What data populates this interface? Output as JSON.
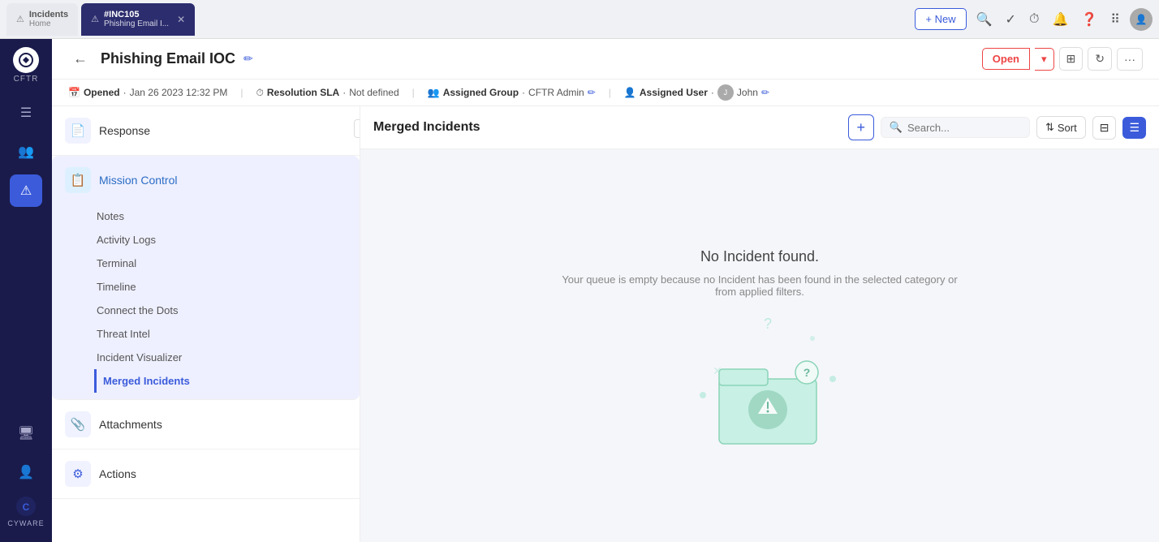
{
  "tabs": [
    {
      "id": "incidents-home",
      "label": "Incidents",
      "sublabel": "Home",
      "icon": "⚠",
      "active": false
    },
    {
      "id": "inc105",
      "label": "#INC105",
      "sublabel": "Phishing Email I...",
      "icon": "⚠",
      "active": true,
      "closable": true
    }
  ],
  "topbar": {
    "new_label": "+ New",
    "icons": [
      "search",
      "check",
      "clock",
      "bell",
      "question",
      "grid",
      "avatar"
    ]
  },
  "header": {
    "back_label": "←",
    "title": "Phishing Email IOC",
    "edit_icon": "✏",
    "status": "Open",
    "status_color": "#e44"
  },
  "meta": {
    "opened_label": "Opened",
    "opened_date": "Jan 26 2023 12:32 PM",
    "resolution_sla_label": "Resolution SLA",
    "resolution_sla_value": "Not defined",
    "assigned_group_label": "Assigned Group",
    "assigned_group_value": "CFTR Admin",
    "assigned_user_label": "Assigned User",
    "assigned_user_value": "John"
  },
  "side_panel": {
    "sections": [
      {
        "id": "response",
        "label": "Response",
        "icon": "📄",
        "expanded": false,
        "sub_items": []
      },
      {
        "id": "mission-control",
        "label": "Mission Control",
        "icon": "📋",
        "expanded": true,
        "sub_items": [
          {
            "id": "notes",
            "label": "Notes",
            "active": false
          },
          {
            "id": "activity-logs",
            "label": "Activity Logs",
            "active": false
          },
          {
            "id": "terminal",
            "label": "Terminal",
            "active": false
          },
          {
            "id": "timeline",
            "label": "Timeline",
            "active": false
          },
          {
            "id": "connect-the-dots",
            "label": "Connect the Dots",
            "active": false
          },
          {
            "id": "threat-intel",
            "label": "Threat Intel",
            "active": false
          },
          {
            "id": "incident-visualizer",
            "label": "Incident Visualizer",
            "active": false
          },
          {
            "id": "merged-incidents",
            "label": "Merged Incidents",
            "active": true
          }
        ]
      },
      {
        "id": "attachments",
        "label": "Attachments",
        "icon": "📎",
        "expanded": false,
        "sub_items": []
      },
      {
        "id": "actions",
        "label": "Actions",
        "icon": "⚙",
        "expanded": false,
        "sub_items": []
      }
    ]
  },
  "main_panel": {
    "title": "Merged Incidents",
    "search_placeholder": "Search...",
    "sort_label": "Sort",
    "add_label": "+",
    "empty_title": "No Incident found.",
    "empty_desc": "Your queue is empty because no Incident has been found in the selected category or from applied filters."
  }
}
